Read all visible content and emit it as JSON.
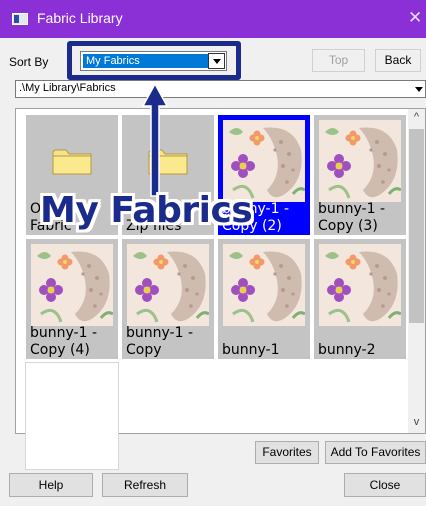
{
  "window": {
    "title": "Fabric Library",
    "close_glyph": "✕"
  },
  "toolbar": {
    "sort_label": "Sort By",
    "sort_value": "My Fabrics",
    "top_label": "Top",
    "back_label": "Back"
  },
  "path": {
    "value": ".\\My Library\\Fabrics"
  },
  "grid": {
    "items": [
      {
        "type": "folder",
        "label_lines": [
          "Ot",
          "Fabric"
        ]
      },
      {
        "type": "folder",
        "label_lines": [
          "",
          "Zip files"
        ]
      },
      {
        "type": "fabric",
        "label_lines": [
          "bunny-1 -",
          "Copy (2)"
        ],
        "selected": true
      },
      {
        "type": "fabric",
        "label_lines": [
          "bunny-1 -",
          "Copy (3)"
        ]
      },
      {
        "type": "fabric",
        "label_lines": [
          "bunny-1 -",
          "Copy (4)"
        ]
      },
      {
        "type": "fabric",
        "label_lines": [
          "bunny-1 -",
          "Copy"
        ]
      },
      {
        "type": "fabric",
        "label_lines": [
          "",
          "bunny-1"
        ]
      },
      {
        "type": "fabric",
        "label_lines": [
          "",
          "bunny-2"
        ]
      },
      {
        "type": "blank",
        "label_lines": [
          "",
          ""
        ]
      }
    ]
  },
  "buttons": {
    "favorites": "Favorites",
    "add_to_favorites": "Add To Favorites",
    "help": "Help",
    "refresh": "Refresh",
    "close": "Close"
  },
  "annotation": {
    "text": "My Fabrics"
  },
  "colors": {
    "titlebar": "#8b2fd6",
    "selection": "#0000ff",
    "annotation": "#1a2b8c"
  }
}
